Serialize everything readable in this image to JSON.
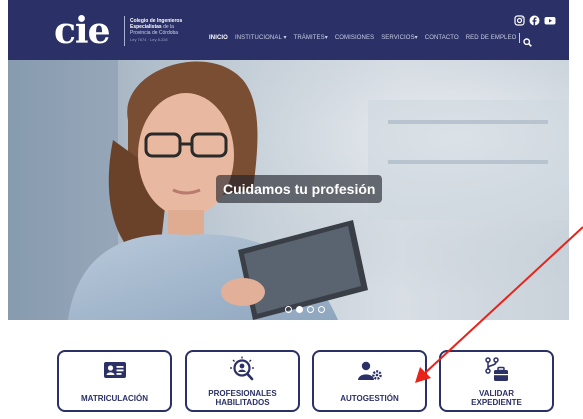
{
  "header": {
    "logo": "cie",
    "org_lines": [
      "Colegio de Ingenieros",
      "Especialistas",
      "de la",
      "Provincia de Córdoba"
    ],
    "org_sub": "Ley 7674 · Ley 8.228",
    "social": [
      {
        "icon": "instagram-icon"
      },
      {
        "icon": "facebook-icon"
      },
      {
        "icon": "youtube-icon"
      }
    ],
    "nav": [
      {
        "label": "INICIO",
        "active": true
      },
      {
        "label": "INSTITUCIONAL",
        "caret": "▾"
      },
      {
        "label": "TRÁMITES",
        "caret": "▾"
      },
      {
        "label": "COMISIONES"
      },
      {
        "label": "SERVICIOS",
        "caret": "▾"
      },
      {
        "label": "CONTACTO"
      },
      {
        "label": "RED DE EMPLEO"
      }
    ]
  },
  "hero": {
    "caption": "Cuidamos tu profesión",
    "slides": 4,
    "active_slide": 1
  },
  "quick_links": [
    {
      "line1": "MATRICULACIÓN",
      "line2": "",
      "icon": "id-card-icon"
    },
    {
      "line1": "PROFESIONALES",
      "line2": "HABILITADOS",
      "icon": "user-search-icon"
    },
    {
      "line1": "AUTOGESTIÓN",
      "line2": "",
      "icon": "user-gear-icon"
    },
    {
      "line1": "VALIDAR",
      "line2": "EXPEDIENTE",
      "icon": "briefcase-branch-icon"
    }
  ],
  "colors": {
    "brand": "#2b3166",
    "annotation": "#e8231a"
  }
}
